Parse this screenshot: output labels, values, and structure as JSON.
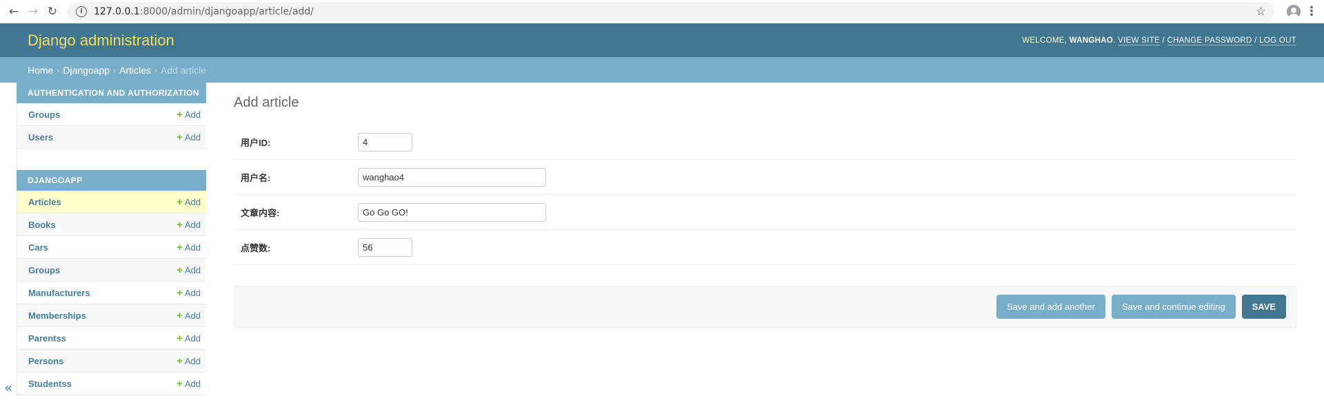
{
  "browser": {
    "url_host": "127.0.0.1",
    "url_rest": ":8000/admin/djangoapp/article/add/"
  },
  "header": {
    "branding": "Django administration",
    "welcome": "WELCOME,",
    "username": "WANGHAO",
    "view_site": "VIEW SITE",
    "change_password": "CHANGE PASSWORD",
    "log_out": "LOG OUT"
  },
  "breadcrumbs": {
    "home": "Home",
    "app": "Djangoapp",
    "model": "Articles",
    "current": "Add article"
  },
  "sidebar": {
    "auth_caption": "AUTHENTICATION AND AUTHORIZATION",
    "auth_models": [
      {
        "name": "Groups",
        "add": "Add"
      },
      {
        "name": "Users",
        "add": "Add"
      }
    ],
    "app_caption": "DJANGOAPP",
    "app_models": [
      {
        "name": "Articles",
        "add": "Add"
      },
      {
        "name": "Books",
        "add": "Add"
      },
      {
        "name": "Cars",
        "add": "Add"
      },
      {
        "name": "Groups",
        "add": "Add"
      },
      {
        "name": "Manufacturers",
        "add": "Add"
      },
      {
        "name": "Memberships",
        "add": "Add"
      },
      {
        "name": "Parentss",
        "add": "Add"
      },
      {
        "name": "Persons",
        "add": "Add"
      },
      {
        "name": "Studentss",
        "add": "Add"
      }
    ],
    "collapse": "«"
  },
  "content": {
    "title": "Add article",
    "fields": [
      {
        "label": "用户ID:",
        "value": "4"
      },
      {
        "label": "用户名:",
        "value": "wanghao4"
      },
      {
        "label": "文章内容:",
        "value": "Go Go GO!"
      },
      {
        "label": "点赞数:",
        "value": "56"
      }
    ],
    "buttons": {
      "save_add_another": "Save and add another",
      "save_continue": "Save and continue editing",
      "save": "SAVE"
    }
  },
  "colors": {
    "header_bg": "#417690",
    "breadcrumb_bg": "#79aec8",
    "branding": "#f5dd5d",
    "link": "#447e9b",
    "add_plus": "#70bf2b",
    "selected_row": "#ffffcc"
  }
}
